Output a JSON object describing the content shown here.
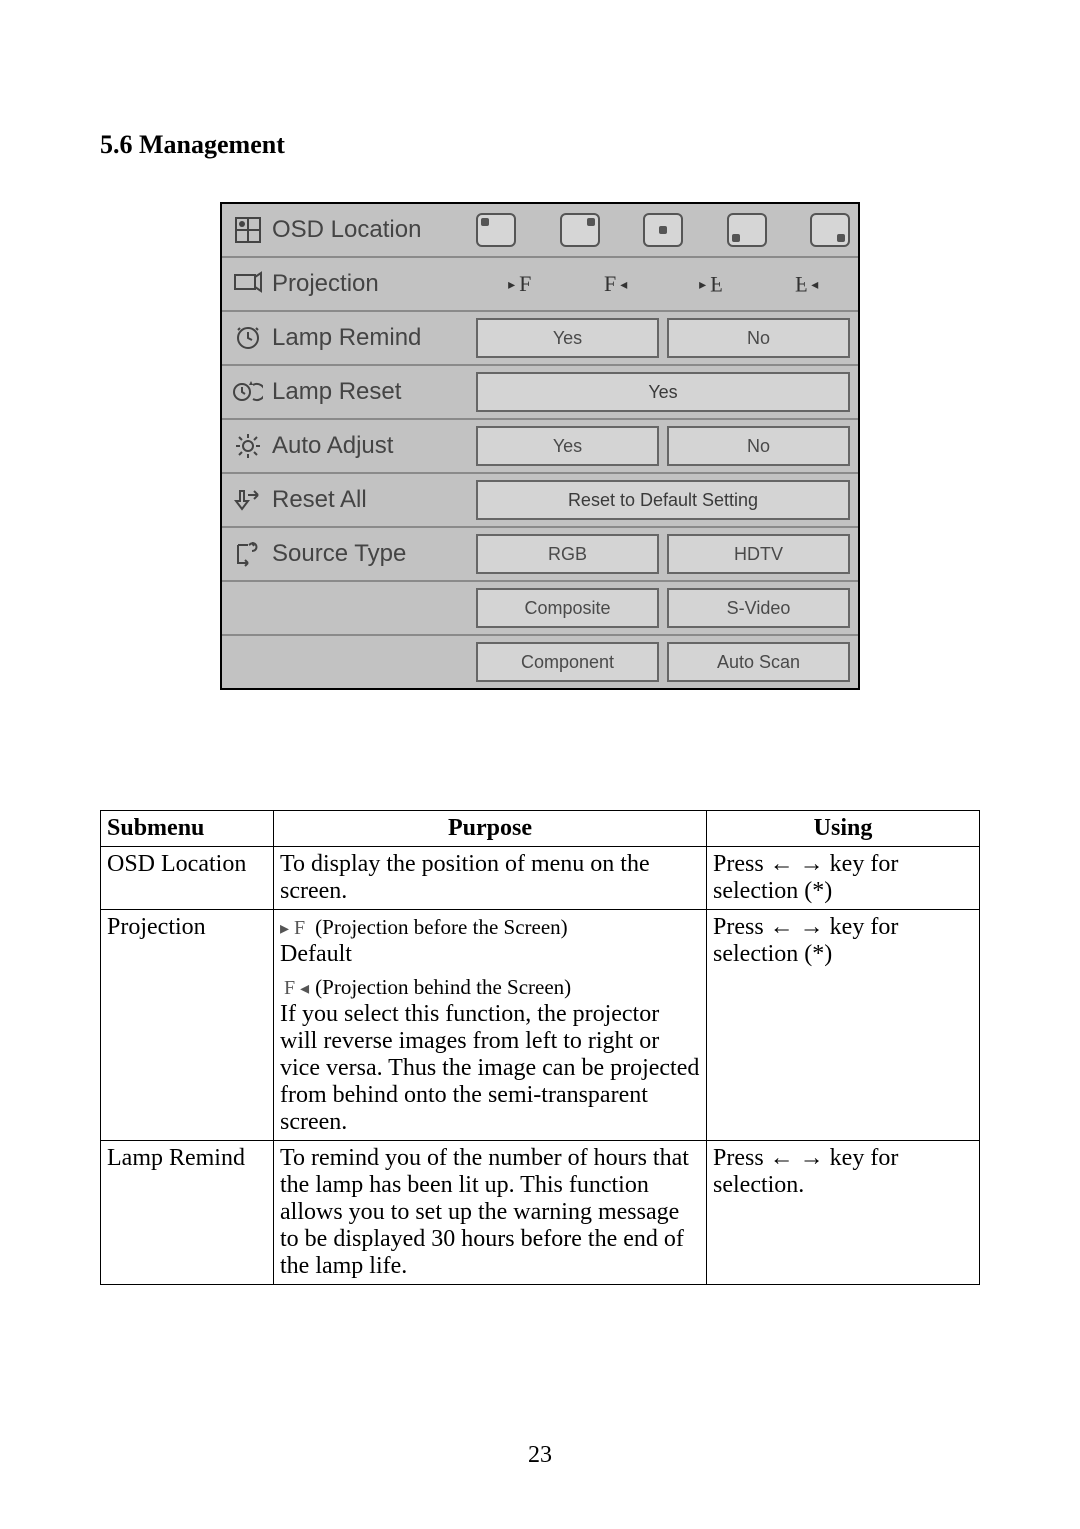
{
  "section_title": "5.6 Management",
  "page_number": "23",
  "osd": {
    "rows": {
      "osd_location": "OSD Location",
      "projection": "Projection",
      "lamp_remind": "Lamp Remind",
      "lamp_reset": "Lamp Reset",
      "auto_adjust": "Auto Adjust",
      "reset_all": "Reset All",
      "source_type": "Source Type"
    },
    "projection_glyphs": [
      "F",
      "F",
      "F",
      "F"
    ],
    "lamp_remind_options": [
      "Yes",
      "No"
    ],
    "lamp_reset_option": "Yes",
    "auto_adjust_options": [
      "Yes",
      "No"
    ],
    "reset_all_option": "Reset to Default Setting",
    "source_type_row1": [
      "RGB",
      "HDTV"
    ],
    "source_type_row2": [
      "Composite",
      "S-Video"
    ],
    "source_type_row3": [
      "Component",
      "Auto Scan"
    ]
  },
  "table": {
    "headers": [
      "Submenu",
      "Purpose",
      "Using"
    ],
    "rows": [
      {
        "submenu": "OSD Location",
        "purpose": "To display the position of menu on the screen.",
        "using_prefix": "Press ",
        "using_arrows": "← →",
        "using_suffix": " key for selection (*)"
      },
      {
        "submenu": "Projection",
        "purpose_parts": {
          "p1": "(Projection before the Screen)",
          "default": "Default",
          "p2": "(Projection behind the Screen)",
          "body": "If you select this function, the projector will reverse images from left to right or vice versa. Thus the image can be projected from behind onto the semi-transparent screen."
        },
        "using_prefix": "Press ",
        "using_arrows": "← →",
        "using_suffix": " key for selection (*)"
      },
      {
        "submenu": "Lamp Remind",
        "purpose": "To remind you of the number of hours that the lamp has been lit up. This function allows you to set up the warning message to be displayed 30 hours before the end of the lamp life.",
        "using_prefix": "Press ",
        "using_arrows": "← →",
        "using_suffix": " key for selection."
      }
    ]
  }
}
